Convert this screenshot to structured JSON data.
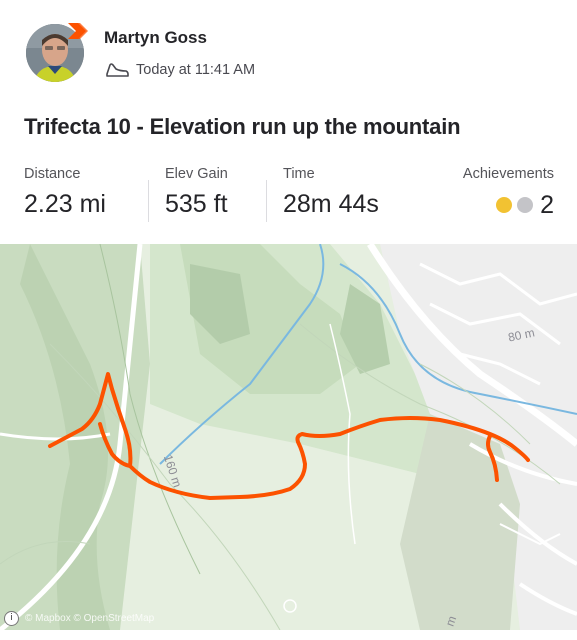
{
  "athlete": {
    "name": "Martyn Goss"
  },
  "activity": {
    "timestamp": "Today at 11:41 AM",
    "title": "Trifecta 10 - Elevation run up the mountain",
    "sport_icon": "running-shoe-icon"
  },
  "stats": [
    {
      "label": "Distance",
      "value": "2.23 mi"
    },
    {
      "label": "Elev Gain",
      "value": "535 ft"
    },
    {
      "label": "Time",
      "value": "28m 44s"
    }
  ],
  "achievements": {
    "label": "Achievements",
    "count": "2",
    "medals": [
      "gold-medal-icon",
      "silver-medal-icon"
    ]
  },
  "map": {
    "contour_labels": [
      "80 m",
      "160 m",
      "m"
    ],
    "attribution": "© Mapbox © OpenStreetMap",
    "route_color": "#fc5200"
  },
  "colors": {
    "brand": "#fc5200",
    "gold": "#f2c232",
    "silver": "#c4c4c8"
  }
}
